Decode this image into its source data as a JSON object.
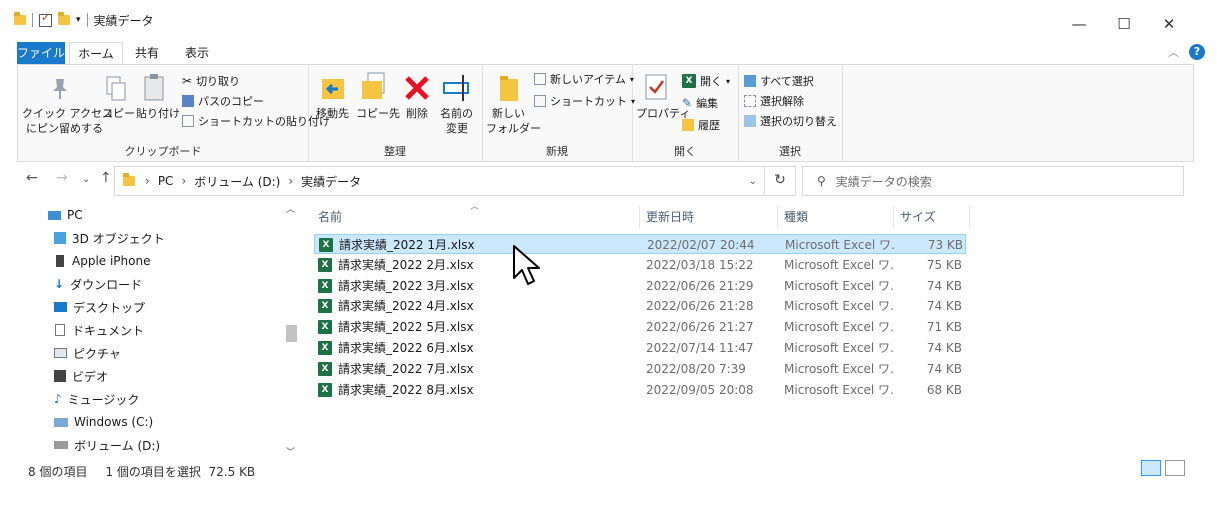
{
  "window": {
    "title": "実績データ",
    "controls": {
      "minimize": "—",
      "maximize": "☐",
      "close": "✕"
    }
  },
  "tabs": [
    {
      "label": "ファイル"
    },
    {
      "label": "ホーム"
    },
    {
      "label": "共有"
    },
    {
      "label": "表示"
    }
  ],
  "ribbon": {
    "clipboard": {
      "label": "クリップボード",
      "pin_line1": "クイック アクセス",
      "pin_line2": "にピン留めする",
      "copy": "コピー",
      "paste": "貼り付け",
      "cut": "切り取り",
      "copy_path": "パスのコピー",
      "paste_shortcut": "ショートカットの貼り付け"
    },
    "organize": {
      "label": "整理",
      "move_to": "移動先",
      "copy_to": "コピー先",
      "delete": "削除",
      "rename_line1": "名前の",
      "rename_line2": "変更"
    },
    "new": {
      "label": "新規",
      "new_folder_line1": "新しい",
      "new_folder_line2": "フォルダー",
      "new_item": "新しいアイテム",
      "shortcut": "ショートカット"
    },
    "open": {
      "label": "開く",
      "properties": "プロパティ",
      "open": "開く",
      "edit": "編集",
      "history": "履歴"
    },
    "select": {
      "label": "選択",
      "select_all": "すべて選択",
      "select_none": "選択解除",
      "invert": "選択の切り替え"
    }
  },
  "address": {
    "path": [
      "PC",
      "ボリューム (D:)",
      "実績データ"
    ],
    "search_placeholder": "実績データの検索"
  },
  "nav_items": [
    {
      "label": "PC",
      "icon": "pc-icon"
    },
    {
      "label": "3D オブジェクト",
      "icon": "3d-objects-icon"
    },
    {
      "label": "Apple iPhone",
      "icon": "phone-icon"
    },
    {
      "label": "ダウンロード",
      "icon": "download-icon"
    },
    {
      "label": "デスクトップ",
      "icon": "desktop-icon"
    },
    {
      "label": "ドキュメント",
      "icon": "document-icon"
    },
    {
      "label": "ピクチャ",
      "icon": "pictures-icon"
    },
    {
      "label": "ビデオ",
      "icon": "video-icon"
    },
    {
      "label": "ミュージック",
      "icon": "music-icon"
    },
    {
      "label": "Windows (C:)",
      "icon": "drive-c-icon"
    },
    {
      "label": "ボリューム (D:)",
      "icon": "drive-d-icon"
    }
  ],
  "columns": {
    "name": "名前",
    "date": "更新日時",
    "type": "種類",
    "size": "サイズ"
  },
  "files": [
    {
      "name": "請求実績_2022 1月.xlsx",
      "date": "2022/02/07 20:44",
      "type": "Microsoft Excel ワ...",
      "size": "73 KB",
      "selected": true
    },
    {
      "name": "請求実績_2022 2月.xlsx",
      "date": "2022/03/18 15:22",
      "type": "Microsoft Excel ワ...",
      "size": "75 KB"
    },
    {
      "name": "請求実績_2022 3月.xlsx",
      "date": "2022/06/26 21:29",
      "type": "Microsoft Excel ワ...",
      "size": "74 KB"
    },
    {
      "name": "請求実績_2022 4月.xlsx",
      "date": "2022/06/26 21:28",
      "type": "Microsoft Excel ワ...",
      "size": "74 KB"
    },
    {
      "name": "請求実績_2022 5月.xlsx",
      "date": "2022/06/26 21:27",
      "type": "Microsoft Excel ワ...",
      "size": "71 KB"
    },
    {
      "name": "請求実績_2022 6月.xlsx",
      "date": "2022/07/14 11:47",
      "type": "Microsoft Excel ワ...",
      "size": "74 KB"
    },
    {
      "name": "請求実績_2022 7月.xlsx",
      "date": "2022/08/20 7:39",
      "type": "Microsoft Excel ワ...",
      "size": "74 KB"
    },
    {
      "name": "請求実績_2022 8月.xlsx",
      "date": "2022/09/05 20:08",
      "type": "Microsoft Excel ワ...",
      "size": "68 KB"
    }
  ],
  "status": {
    "count": "8 個の項目",
    "selection": "1 個の項目を選択  72.5 KB"
  },
  "colors": {
    "accent": "#1979ca",
    "selection_bg": "#cce8ff",
    "excel_green": "#1e7145",
    "folder_yellow": "#f5c542",
    "delete_red": "#e81123"
  }
}
